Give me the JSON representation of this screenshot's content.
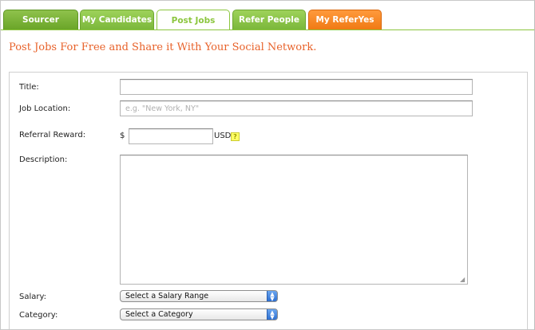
{
  "tabs": [
    {
      "label": "Sourcer",
      "state": "inactive",
      "color": "#6aa528"
    },
    {
      "label": "My Candidates",
      "state": "inactive",
      "color": "#7bb73b"
    },
    {
      "label": "Post Jobs",
      "state": "active",
      "color": "#ffffff"
    },
    {
      "label": "Refer People",
      "state": "inactive",
      "color": "#7bb73b"
    },
    {
      "label": "My ReferYes",
      "state": "inactive",
      "color": "#f07a14"
    }
  ],
  "headline": "Post Jobs For Free and Share it With Your Social Network.",
  "form": {
    "title_label": "Title:",
    "title_value": "",
    "location_label": "Job Location:",
    "location_placeholder": "e.g. \"New York, NY\"",
    "reward_label": "Referral Reward:",
    "reward_currency_symbol": "$",
    "reward_value": "",
    "reward_unit": "USD",
    "reward_help": "?",
    "description_label": "Description:",
    "description_value": "",
    "salary_label": "Salary:",
    "salary_selected": "Select a Salary Range",
    "category_label": "Category:",
    "category_selected": "Select a Category"
  },
  "colors": {
    "accent_green": "#8cc63f",
    "headline_orange": "#e8622a",
    "tab_orange": "#f07a14"
  }
}
